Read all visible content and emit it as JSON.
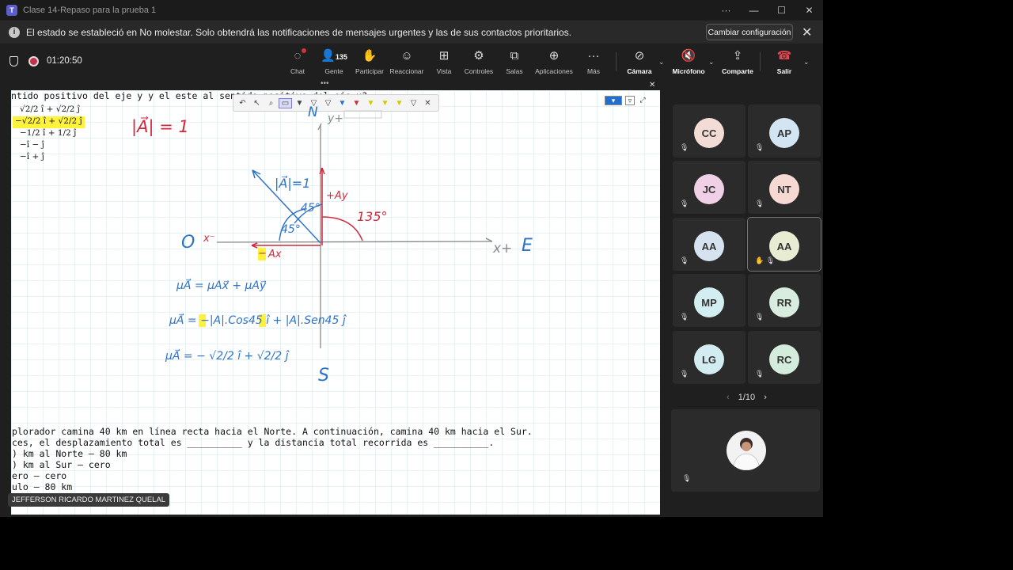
{
  "window": {
    "title": "Clase 14-Repaso para la prueba 1",
    "more": "···",
    "minimize": "—",
    "maximize": "☐",
    "close": "✕"
  },
  "notification": {
    "text": "El estado se estableció en No molestar. Solo obtendrá las notificaciones de mensajes urgentes y las de sus contactos prioritarios.",
    "button": "Cambiar configuración"
  },
  "call": {
    "timer": "01:20:50",
    "people_count": "135",
    "toolbar": [
      {
        "id": "chat",
        "label": "Chat",
        "icon": "chat-icon"
      },
      {
        "id": "people",
        "label": "Gente",
        "icon": "people-icon"
      },
      {
        "id": "raise",
        "label": "Participar",
        "icon": "hand-icon"
      },
      {
        "id": "react",
        "label": "Reaccionar",
        "icon": "smile-icon"
      },
      {
        "id": "view",
        "label": "Vista",
        "icon": "grid-icon"
      },
      {
        "id": "controls",
        "label": "Controles",
        "icon": "controls-icon"
      },
      {
        "id": "rooms",
        "label": "Salas",
        "icon": "rooms-icon"
      },
      {
        "id": "apps",
        "label": "Aplicaciones",
        "icon": "plus-icon"
      },
      {
        "id": "more",
        "label": "Más",
        "icon": "more-icon"
      },
      {
        "id": "camera",
        "label": "Cámara",
        "icon": "camera-off-icon"
      },
      {
        "id": "mic",
        "label": "Micrófono",
        "icon": "mic-off-icon"
      },
      {
        "id": "share",
        "label": "Comparte",
        "icon": "share-icon"
      },
      {
        "id": "leave",
        "label": "Salir",
        "icon": "phone-hangup-icon"
      }
    ]
  },
  "whiteboard": {
    "top_line": "ntido positivo del eje y y el este al sentido positivo del eje x?",
    "options": [
      "√2/2 ı̂ + √2/2 ȷ̂",
      "−√2/2 ı̂ + √2/2 ȷ̂",
      "−1/2 ı̂ + 1/2 ȷ̂",
      "−ı̂ − ȷ̂",
      "−ı̂ + ȷ̂"
    ],
    "question_lines": [
      "plorador camina 40 km en línea recta hacia el Norte. A continuación, camina 40 km hacia el Sur.",
      "ces, el desplazamiento total es __________ y la distancia total recorrida es __________.",
      ") km al Norte — 80 km",
      ") km al Sur — cero",
      "ero — cero",
      "ulo — 80 km"
    ],
    "handwriting": {
      "mag_top": "|A⃗| = 1",
      "north": "N",
      "yplus": "y+",
      "mag_vec": "|A⃗|=1",
      "ay": "+Ay",
      "angle_red": "135°",
      "angle1": "45°",
      "angle2": "45°",
      "west": "O",
      "xminus": "x⁻",
      "xplus": "x+",
      "east": "E",
      "ax": "Ax",
      "ax_sign": "−",
      "south": "S",
      "eq1": "μA⃗ = μAx⃗ + μAy⃗",
      "eq2": "μA⃗ = −|A|.Cos45 ı̂ + |A|.Sen45 ȷ̂",
      "eq3": "μA⃗ = − √2/2 ı̂ + √2/2 ȷ̂"
    }
  },
  "presenter_name": "JEFFERSON RICARDO MARTINEZ QUELAL",
  "participants": [
    {
      "initials": "CC",
      "color": "#f3dcd6"
    },
    {
      "initials": "AP",
      "color": "#d3e4f2"
    },
    {
      "initials": "JC",
      "color": "#f0d0e6"
    },
    {
      "initials": "NT",
      "color": "#f7d9d4"
    },
    {
      "initials": "AA",
      "color": "#d6e2f0"
    },
    {
      "initials": "AA",
      "color": "#e7ecd2"
    },
    {
      "initials": "MP",
      "color": "#d2eef0"
    },
    {
      "initials": "RR",
      "color": "#d8eddf"
    },
    {
      "initials": "LG",
      "color": "#d2ecf1"
    },
    {
      "initials": "RC",
      "color": "#d3ecdc"
    }
  ],
  "pager": {
    "text": "1/10",
    "prev": "‹",
    "next": "›"
  },
  "mute_symbol": "🎙̸",
  "accent": "#5b5fc7",
  "whiteboard_ink_blue": "#2e72c8",
  "whiteboard_ink_red": "#d0283c"
}
